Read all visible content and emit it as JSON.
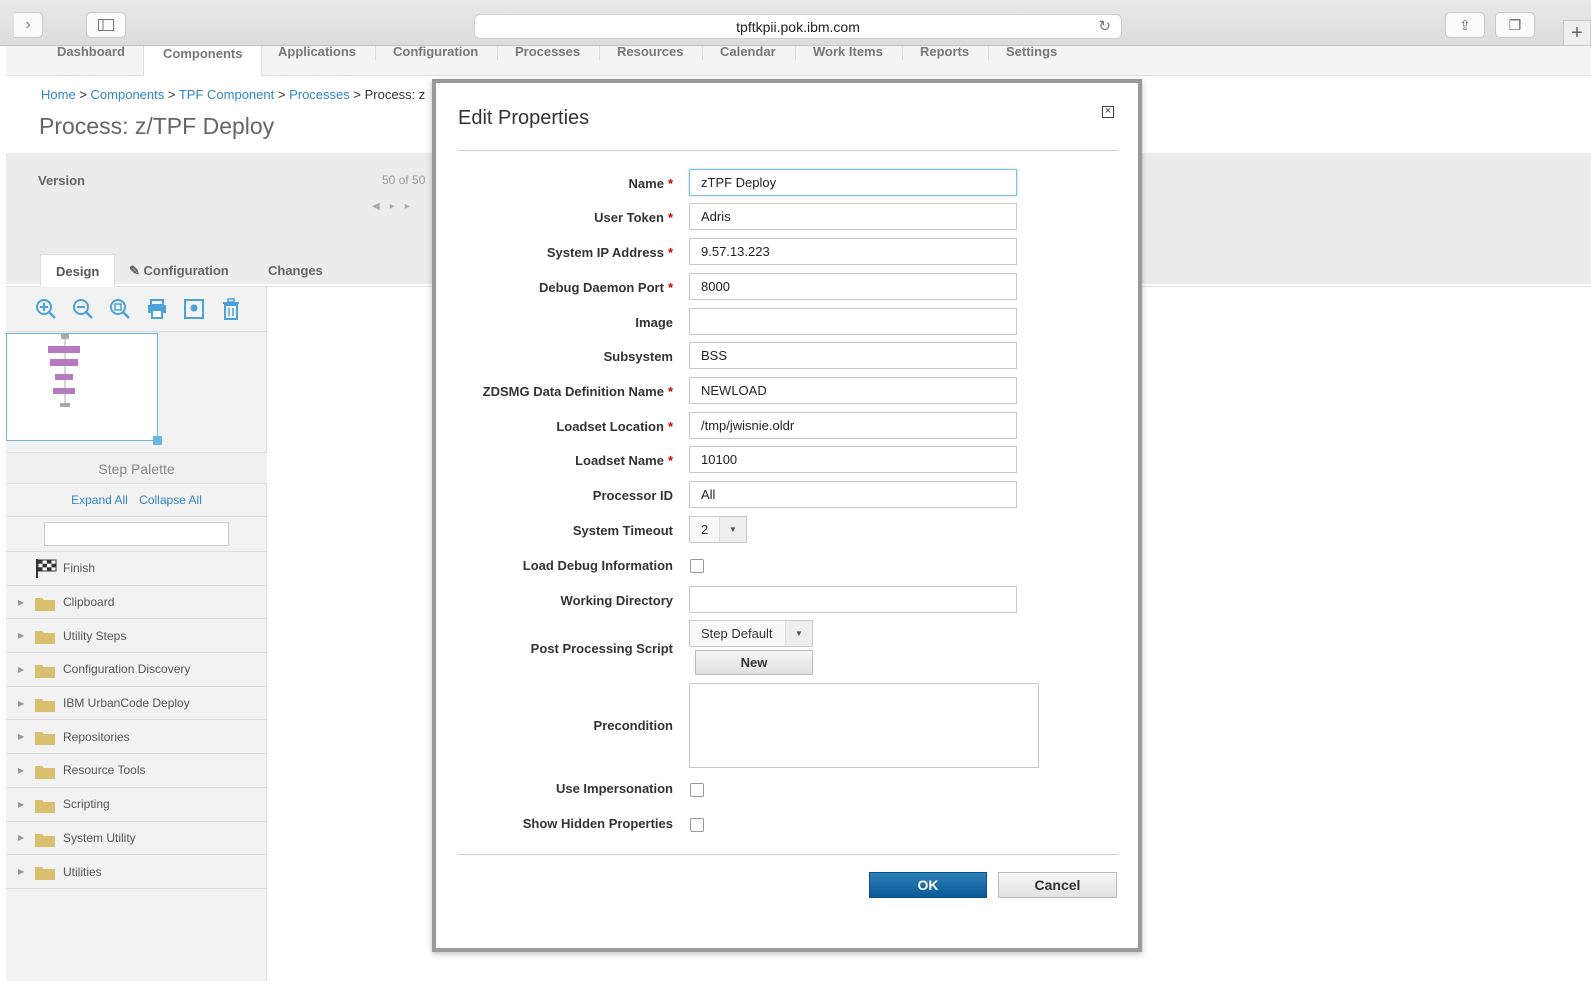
{
  "browser": {
    "url": "tpftkpii.pok.ibm.com"
  },
  "topnav": {
    "tabs": [
      "Dashboard",
      "Components",
      "Applications",
      "Configuration",
      "Processes",
      "Resources",
      "Calendar",
      "Work Items",
      "Reports",
      "Settings"
    ],
    "active": "Components"
  },
  "breadcrumb": {
    "items": [
      "Home",
      "Components",
      "TPF Component",
      "Processes"
    ],
    "separator": ">",
    "current": "Process: z"
  },
  "page": {
    "title": "Process: z/TPF Deploy"
  },
  "version": {
    "label": "Version",
    "count": "50 of 50"
  },
  "design_tabs": {
    "design": "Design",
    "configuration": "Configuration",
    "changes": "Changes"
  },
  "palette": {
    "title": "Step Palette",
    "expand_all": "Expand All",
    "collapse_all": "Collapse All",
    "items": [
      "Finish",
      "Clipboard",
      "Utility Steps",
      "Configuration Discovery",
      "IBM UrbanCode Deploy",
      "Repositories",
      "Resource Tools",
      "Scripting",
      "System Utility",
      "Utilities"
    ]
  },
  "dialog": {
    "title": "Edit Properties",
    "close_glyph": "×",
    "fields": {
      "name": {
        "label": "Name",
        "value": "zTPF Deploy"
      },
      "user_token": {
        "label": "User Token",
        "value": "Adris"
      },
      "system_ip": {
        "label": "System IP Address",
        "value": "9.57.13.223"
      },
      "debug_port": {
        "label": "Debug Daemon Port",
        "value": "8000"
      },
      "image": {
        "label": "Image",
        "value": ""
      },
      "subsystem": {
        "label": "Subsystem",
        "value": "BSS"
      },
      "zdsmg": {
        "label": "ZDSMG Data Definition Name",
        "value": "NEWLOAD"
      },
      "loadset_location": {
        "label": "Loadset Location",
        "value": "/tmp/jwisnie.oldr"
      },
      "loadset_name": {
        "label": "Loadset Name",
        "value": "10100"
      },
      "processor_id": {
        "label": "Processor ID",
        "value": "All"
      },
      "system_timeout": {
        "label": "System Timeout",
        "value": "2"
      },
      "load_debug": {
        "label": "Load Debug Information",
        "checked": false
      },
      "working_dir": {
        "label": "Working Directory",
        "value": ""
      },
      "post_script": {
        "label": "Post Processing Script",
        "value": "Step Default",
        "new_label": "New"
      },
      "precondition": {
        "label": "Precondition",
        "value": ""
      },
      "use_impersonation": {
        "label": "Use Impersonation",
        "checked": false
      },
      "show_hidden": {
        "label": "Show Hidden Properties",
        "checked": false
      }
    },
    "required_mark": "*",
    "ok_label": "OK",
    "cancel_label": "Cancel"
  },
  "colors": {
    "link": "#2f86c9",
    "ok_button": "#0a5a96",
    "required": "#cc0000",
    "preview_step": "#b57bc2"
  }
}
